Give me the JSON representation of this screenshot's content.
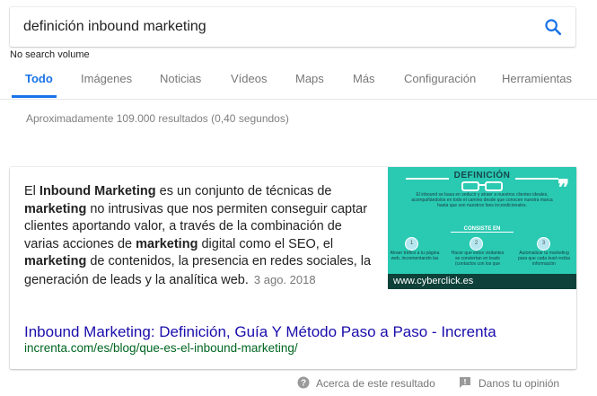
{
  "search": {
    "query": "definición inbound marketing",
    "volume_note": "No search volume"
  },
  "tabs": [
    {
      "label": "Todo",
      "active": true
    },
    {
      "label": "Imágenes"
    },
    {
      "label": "Noticias"
    },
    {
      "label": "Vídeos"
    },
    {
      "label": "Maps"
    },
    {
      "label": "Más"
    },
    {
      "label": "Configuración"
    },
    {
      "label": "Herramientas"
    }
  ],
  "results_stats": "Aproximadamente 109.000 resultados (0,40 segundos)",
  "featured_snippet": {
    "parts": [
      {
        "text": "El ",
        "bold": false
      },
      {
        "text": "Inbound Marketing",
        "bold": true
      },
      {
        "text": " es un conjunto de técnicas de ",
        "bold": false
      },
      {
        "text": "marketing",
        "bold": true
      },
      {
        "text": " no intrusivas que nos permiten conseguir captar clientes aportando valor, a través de la combinación de varias acciones de ",
        "bold": false
      },
      {
        "text": "marketing",
        "bold": true
      },
      {
        "text": " digital como el SEO, el ",
        "bold": false
      },
      {
        "text": "marketing",
        "bold": true
      },
      {
        "text": " de contenidos, la presencia en redes sociales, la generación de leads y la analítica web.",
        "bold": false
      }
    ],
    "date": "3 ago. 2018",
    "image": {
      "heading": "DEFINICIÓN",
      "intro": "El inbound se basa en seducir y atraer a nuestros clientes ideales, acompañándolos en todo el camino desde que conocen nuestra marca hasta que son nuestros fans incondicionales.",
      "subheading": "CONSISTE EN",
      "steps": [
        {
          "num": "1",
          "text": "Atraer tráfico a tu página web, incrementando las"
        },
        {
          "num": "2",
          "text": "Hacer que estos visitantes se conviertan en leads (contactos con los que"
        },
        {
          "num": "3",
          "text": "Automatizar tu marketing para que cada lead reciba información"
        }
      ],
      "watermark": "www.cyberclick.es",
      "bg_color": "#2ac9b2"
    },
    "title": "Inbound Marketing: Definición, Guía Y Método Paso a Paso - Increnta",
    "url": "increnta.com/es/blog/que-es-el-inbound-marketing/"
  },
  "footer": {
    "about_label": "Acerca de este resultado",
    "feedback_label": "Danos tu opinión"
  },
  "colors": {
    "accent": "#1a73e8",
    "link": "#1a0dab",
    "url": "#006621"
  }
}
